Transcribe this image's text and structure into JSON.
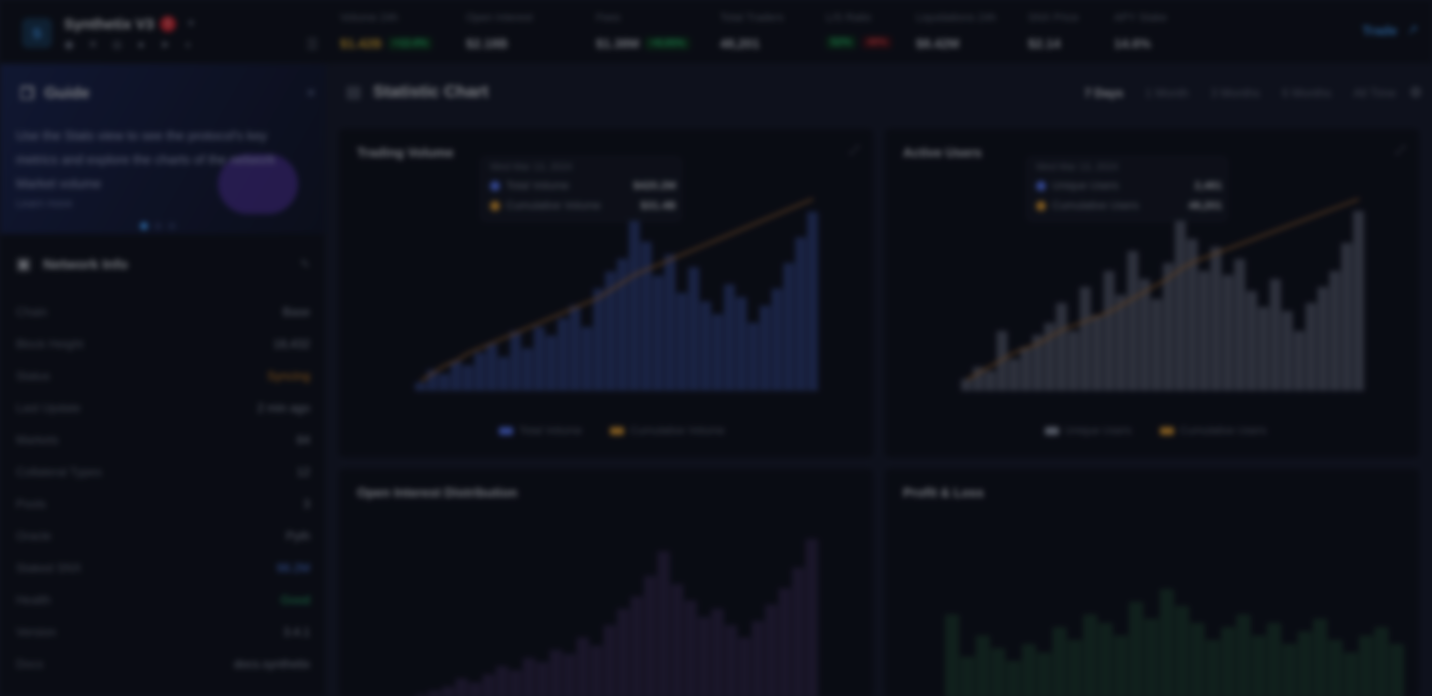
{
  "brand": {
    "name": "Synthetix V3",
    "badge": "1",
    "icons": [
      "discord-icon",
      "twitter-icon",
      "github-icon",
      "docs-icon",
      "telegram-icon",
      "mirror-icon"
    ]
  },
  "topbar": {
    "stats": [
      {
        "label": "Volume 24h",
        "value": "$1.42B",
        "pill": "+12.4%",
        "pill_color": "green",
        "value_color": "yellow"
      },
      {
        "label": "Open Interest",
        "value": "$2.18B"
      },
      {
        "label": "Fees",
        "value": "$1.38M",
        "pill": "+8.05%",
        "pill_color": "green"
      },
      {
        "label": "Total Traders",
        "value": "48,201"
      },
      {
        "label": "L/S Ratio",
        "value": "",
        "pills": [
          {
            "text": "52%",
            "color": "green"
          },
          {
            "text": "48%",
            "color": "red"
          }
        ]
      },
      {
        "label": "Liquidations 24h",
        "value": "$8.42M"
      },
      {
        "label": "SNX Price",
        "value": "$2.14"
      },
      {
        "label": "APY Stake",
        "value": "14.6%"
      }
    ],
    "trade_label": "Trade",
    "colors": {
      "accent": "#47a2ff",
      "green": "#2fc27a",
      "red": "#e5484d",
      "yellow": "#e6b43a"
    }
  },
  "sidebar": {
    "guide": {
      "title": "Guide",
      "text": "Use the Stats view to see the protocol's key metrics and explore the charts of the network Market volume",
      "link": "Learn more"
    },
    "section": {
      "title": "Network Info",
      "items": [
        {
          "k": "Chain",
          "v": "Base",
          "color": ""
        },
        {
          "k": "Block Height",
          "v": "18,432",
          "color": ""
        },
        {
          "k": "Status",
          "v": "Syncing",
          "color": "orange"
        },
        {
          "k": "Last Update",
          "v": "2 min ago",
          "color": ""
        },
        {
          "k": "Markets",
          "v": "84",
          "color": ""
        },
        {
          "k": "Collateral Types",
          "v": "12",
          "color": ""
        },
        {
          "k": "Pools",
          "v": "3",
          "color": ""
        },
        {
          "k": "Oracle",
          "v": "Pyth",
          "color": ""
        },
        {
          "k": "Staked SNX",
          "v": "98.2M",
          "color": "blue"
        },
        {
          "k": "Health",
          "v": "Good",
          "color": "green"
        },
        {
          "k": "Version",
          "v": "3.4.1",
          "color": ""
        },
        {
          "k": "Docs",
          "v": "docs.synthetix",
          "color": ""
        }
      ]
    }
  },
  "main": {
    "title": "Statistic Chart",
    "ranges": [
      "7 Days",
      "1 Month",
      "3 Months",
      "6 Months",
      "All Time"
    ],
    "active_range": "7 Days",
    "cards": [
      {
        "title": "Trading Volume",
        "tooltip_header": "Wed Mar 13, 2024",
        "rows": [
          {
            "name": "Total Volume",
            "value": "$420.2M",
            "color": "#5b7cff"
          },
          {
            "name": "Cumulative Volume",
            "value": "$31.4B",
            "color": "#e6a23a"
          }
        ],
        "legend": [
          "Total Volume",
          "Cumulative Volume"
        ]
      },
      {
        "title": "Active Users",
        "tooltip_header": "Wed Mar 13, 2024",
        "rows": [
          {
            "name": "Unique Users",
            "value": "2,481",
            "color": "#5b7cff"
          },
          {
            "name": "Cumulative Users",
            "value": "48,201",
            "color": "#e6a23a"
          }
        ],
        "legend": [
          "Unique Users",
          "Cumulative Users"
        ]
      },
      {
        "title": "Open Interest Distribution",
        "legend": []
      },
      {
        "title": "Profit & Loss",
        "legend": []
      }
    ]
  },
  "chart_data": [
    {
      "type": "bar",
      "title": "Trading Volume",
      "series": [
        {
          "name": "Total Volume",
          "values": [
            4,
            10,
            8,
            14,
            12,
            18,
            22,
            16,
            28,
            20,
            30,
            26,
            34,
            40,
            30,
            48,
            56,
            62,
            90,
            70,
            54,
            64,
            46,
            58,
            42,
            36,
            50,
            44,
            32,
            40,
            48,
            60,
            72,
            84
          ]
        },
        {
          "name": "Cumulative Volume",
          "values": [
            8,
            14,
            20,
            24,
            30,
            34,
            38,
            42,
            46,
            50,
            54,
            58,
            62,
            66,
            70,
            74,
            80,
            86,
            92,
            96,
            100,
            104,
            108,
            112,
            116,
            120,
            124,
            128,
            132,
            136,
            140,
            144,
            148,
            152
          ]
        }
      ]
    },
    {
      "type": "bar",
      "title": "Active Users",
      "series": [
        {
          "name": "Unique Users",
          "values": [
            6,
            12,
            10,
            30,
            16,
            22,
            28,
            34,
            44,
            30,
            52,
            38,
            60,
            48,
            70,
            56,
            46,
            64,
            96,
            76,
            60,
            72,
            58,
            66,
            50,
            42,
            56,
            40,
            30,
            44,
            52,
            60,
            74,
            90
          ]
        },
        {
          "name": "Cumulative Users",
          "values": [
            10,
            16,
            22,
            28,
            34,
            38,
            42,
            48,
            54,
            58,
            62,
            66,
            70,
            76,
            82,
            88,
            94,
            100,
            108,
            114,
            118,
            122,
            126,
            130,
            134,
            138,
            142,
            146,
            150,
            154,
            158,
            162,
            166,
            170
          ]
        }
      ]
    },
    {
      "type": "bar",
      "title": "Open Interest Distribution",
      "series": [
        {
          "name": "",
          "values": [
            2,
            4,
            6,
            10,
            8,
            12,
            16,
            14,
            20,
            18,
            24,
            22,
            30,
            26,
            36,
            44,
            50,
            60,
            72,
            56,
            48,
            40,
            44,
            36,
            30,
            38,
            46,
            54,
            64,
            78
          ]
        }
      ]
    },
    {
      "type": "bar",
      "title": "Profit & Loss",
      "series": [
        {
          "name": "",
          "values": [
            40,
            20,
            30,
            24,
            18,
            26,
            22,
            34,
            28,
            40,
            36,
            30,
            46,
            38,
            52,
            44,
            36,
            28,
            34,
            40,
            30,
            36,
            26,
            32,
            38,
            28,
            22,
            30,
            34,
            26
          ]
        }
      ]
    }
  ]
}
